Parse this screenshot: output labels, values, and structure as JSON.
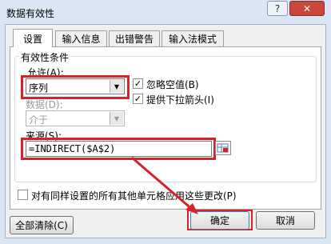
{
  "window": {
    "title": "数据有效性",
    "help_label": "?",
    "close_label": "✕"
  },
  "tabs": [
    {
      "label": "设置"
    },
    {
      "label": "输入信息"
    },
    {
      "label": "出错警告"
    },
    {
      "label": "输入法模式"
    }
  ],
  "settings": {
    "group_title": "有效性条件",
    "allow_label": "允许(A):",
    "allow_value": "序列",
    "ignore_blank_label": "忽略空值(B)",
    "dropdown_label": "提供下拉箭头(I)",
    "data_label": "数据(D):",
    "data_value": "介于",
    "source_label": "来源(S):",
    "source_value": "=INDIRECT($A$2)",
    "apply_all_label": "对有同样设置的所有其他单元格应用这些更改(P)"
  },
  "buttons": {
    "clear_all": "全部清除(C)",
    "ok": "确定",
    "cancel": "取消"
  },
  "colors": {
    "highlight": "#d6232a",
    "titlebar_bg": "#dbe6f4",
    "close_bg": "#c9473b"
  },
  "icons": {
    "checkmark": "check-icon",
    "dropdown": "chevron-down-icon",
    "range_picker": "range-selector-icon"
  }
}
